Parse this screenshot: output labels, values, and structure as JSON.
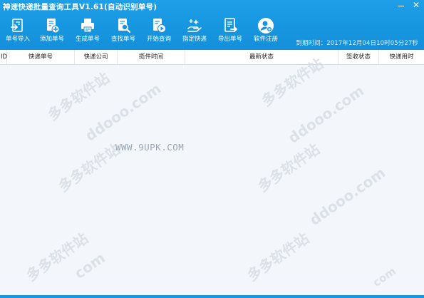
{
  "window": {
    "title": "神速快递批量查询工具V1.61(自动识别单号)",
    "minimize_icon": "minimize-icon",
    "close_icon": "close-icon"
  },
  "toolbar": {
    "items": [
      {
        "label": "单号导入",
        "icon": "import-icon"
      },
      {
        "label": "添加单号",
        "icon": "add-document-icon"
      },
      {
        "label": "生成单号",
        "icon": "printer-icon"
      },
      {
        "label": "查找单号",
        "icon": "search-document-icon"
      },
      {
        "label": "开始查询",
        "icon": "play-document-icon"
      },
      {
        "label": "指定快递",
        "icon": "hand-select-icon"
      },
      {
        "label": "导出单号",
        "icon": "export-document-icon"
      },
      {
        "label": "软件注册",
        "icon": "user-register-icon"
      }
    ]
  },
  "time_label": "到期时间：2017年12月04日10时05分27秒",
  "table": {
    "columns": [
      "ID",
      "快递单号",
      "快递公司",
      "揽件时间",
      "最新状态",
      "签收状态",
      "快递用时"
    ],
    "rows": []
  },
  "watermarks": {
    "center": "WWW.9UPK.COM",
    "site": "ddooo.com",
    "site_name": "多多软件站",
    "site_short": "com"
  },
  "colors": {
    "header": "#1796e0",
    "table_body": "#f3f7fb",
    "watermark": "#d9dfe6"
  }
}
